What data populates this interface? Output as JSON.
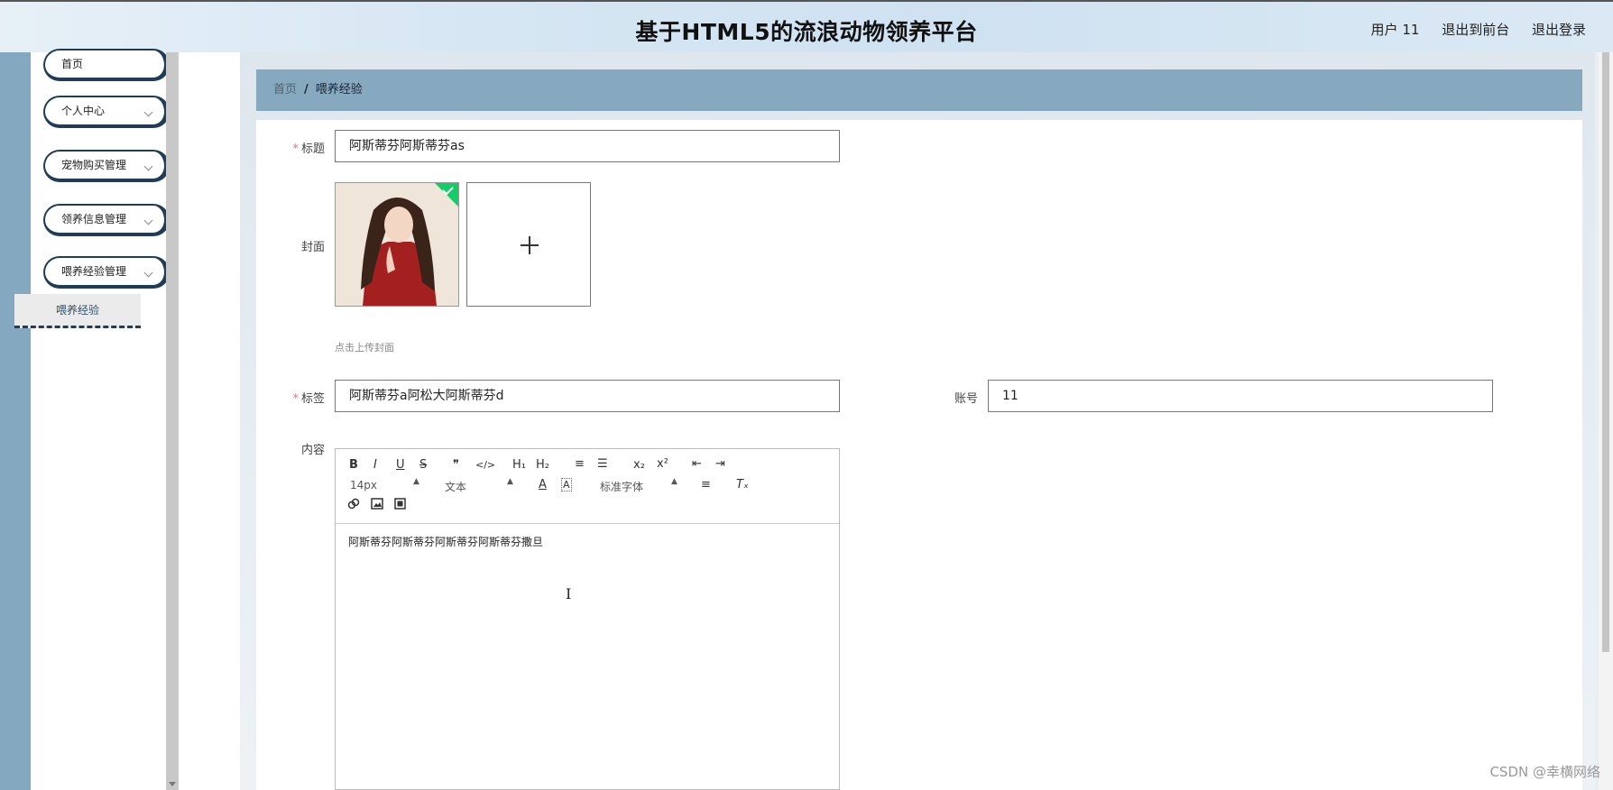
{
  "header": {
    "title": "基于HTML5的流浪动物领养平台",
    "user_label": "用户 11",
    "to_front_label": "退出到前台",
    "logout_label": "退出登录"
  },
  "sidebar": {
    "items": [
      {
        "label": "首页"
      },
      {
        "label": "个人中心"
      },
      {
        "label": "宠物购买管理"
      },
      {
        "label": "领养信息管理"
      },
      {
        "label": "喂养经验管理"
      }
    ],
    "subitem": "喂养经验"
  },
  "breadcrumb": {
    "home": "首页",
    "separator": "/",
    "current": "喂养经验"
  },
  "form": {
    "title_label": "标题",
    "title_value": "阿斯蒂芬阿斯蒂芬as",
    "cover_label": "封面",
    "cover_hint": "点击上传封面",
    "tags_label": "标签",
    "tags_value": "阿斯蒂芬a阿松大阿斯蒂芬d",
    "account_label": "账号",
    "account_value": "11",
    "content_label": "内容",
    "required_mark": "*"
  },
  "editor": {
    "buttons": {
      "bold": "B",
      "italic": "I",
      "underline": "U",
      "strike": "S",
      "quote": "❞",
      "code": "</>",
      "h1": "H₁",
      "h2": "H₂",
      "ordered": "≡",
      "bullet": "☰",
      "sub": "x₂",
      "sup": "x²",
      "outdent": "⇤",
      "indent": "⇥",
      "color": "A",
      "bg": "A",
      "align": "≡",
      "clean": "Tₓ",
      "link": "🔗",
      "image": "▣",
      "video": "▤"
    },
    "size_select": "14px",
    "header_select": "文本",
    "font_select": "标准字体",
    "content": "阿斯蒂芬阿斯蒂芬阿斯蒂芬阿斯蒂芬撒旦",
    "cursor": "I"
  },
  "watermark": "CSDN @幸横网络"
}
